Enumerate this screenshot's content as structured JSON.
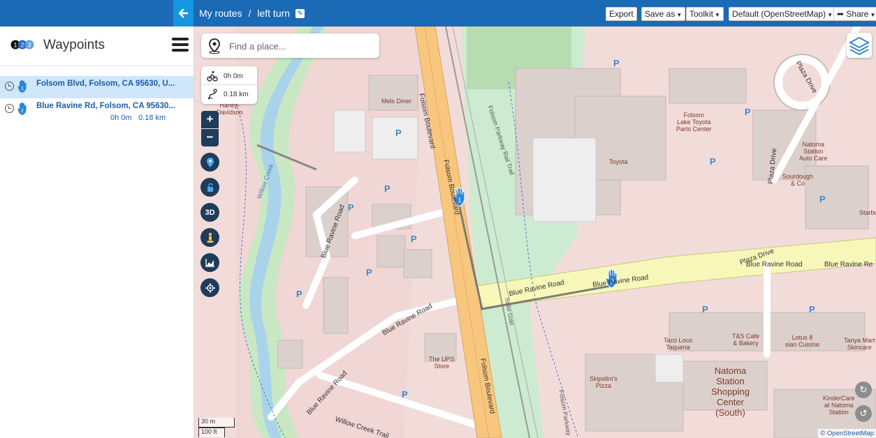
{
  "header": {
    "back_icon": "arrow-left-icon",
    "crumb_root": "My routes",
    "crumb_sep": "/",
    "route_name": "left turn",
    "edit_icon": "edit-icon",
    "buttons": {
      "export": "Export",
      "save_as": "Save as",
      "toolkit": "Toolkit",
      "map_style": "Default (OpenStreetMap)",
      "share": "Share"
    }
  },
  "sidebar": {
    "logo_digits": [
      "1",
      "2",
      "3"
    ],
    "title": "Waypoints",
    "waypoints": [
      {
        "number": "1",
        "name": "Folsom Blvd, Folsom, CA 95630, U...",
        "selected": true
      },
      {
        "number": "2",
        "name": "Blue Ravine Rd, Folsom, CA 95630...",
        "duration": "0h 0m",
        "distance": "0.18 km",
        "selected": false
      }
    ]
  },
  "map": {
    "search_placeholder": "Find a place...",
    "stats": {
      "duration": "0h 0m",
      "distance": "0.18 km"
    },
    "controls": {
      "zoom_in": "+",
      "zoom_out": "−",
      "three_d": "3D",
      "icons": [
        "add-poi-icon",
        "lock-icon",
        "3d-icon",
        "street-view-icon",
        "elevation-chart-icon",
        "locate-icon"
      ]
    },
    "scale": {
      "metric": "30 m",
      "imperial": "100 ft"
    },
    "attribution": "© OpenStreetMap",
    "markers": [
      "1",
      "2"
    ],
    "labels": {
      "streets": {
        "folsom_blvd_1": "Folsom Boulevard",
        "folsom_blvd_2": "Folsom Boulevard",
        "folsom_blvd_3": "Folsom Boulevard",
        "blue_ravine_1": "Blue Ravine Road",
        "blue_ravine_2": "Blue Ravine Road",
        "blue_ravine_3": "Blue Ravine Road",
        "blue_ravine_4": "Blue Ravine Road",
        "blue_ravine_5": "Blue Ravine Road",
        "blue_ravine_6": "Blue Ravine Road",
        "blue_ravine_7": "Blue Ravine Road",
        "blue_ravine_8": "Blue Ravine Re",
        "plaza_drive_1": "Plaza Drive",
        "plaza_drive_2": "Plaza Drive",
        "plaza_drive_3": "Plaza Drive",
        "willow_creek_trail": "Willow Creek Trail",
        "willow_creek": "Willow Creek",
        "rail_trail": "Folsom Parkway Rail Trail",
        "folsom_parkway": "Folsom Parkway",
        "sailor": "Sailor Gold"
      },
      "pois": {
        "harley": "Harley-\nDavidson",
        "mels": "Mels Diner",
        "toyota": "Toyota",
        "lake_toyota": "Folsom\nLake Toyota\nParts Center",
        "natoma_auto": "Natoma\nStation\nAuto Care",
        "sourdough": "Sourdough\n& Co",
        "starbucks": "Starbu",
        "ups": "The UPS\nStore",
        "skipolinis": "Skipolini's\nPizza",
        "taco_loco": "Taco Loco\nTaqueria",
        "ts_cafe": "T&S Cafe\n& Bakery",
        "lotus": "Lotus 8\nsian Cuisine",
        "tanya": "Tanya Mart\nSkincare",
        "kindercare": "KinderCare\nat Natoma\nStation",
        "natoma_center": "Natoma\nStation\nShopping\nCenter\n(South)"
      },
      "parking": "P"
    }
  }
}
